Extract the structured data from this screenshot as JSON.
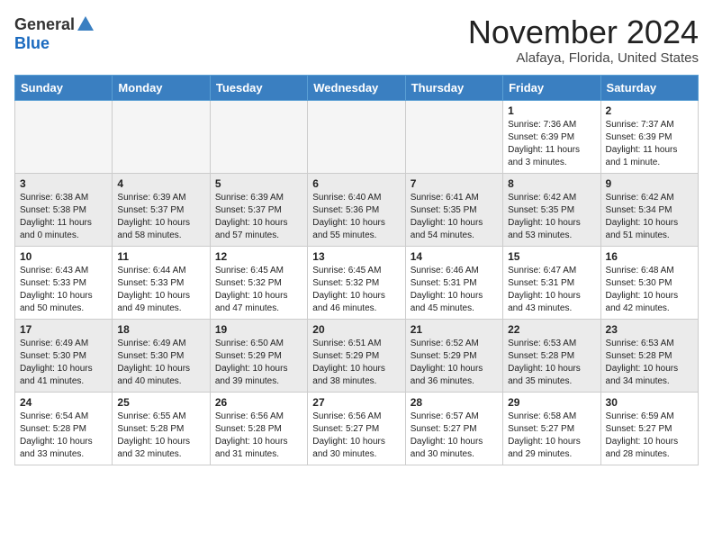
{
  "header": {
    "logo_general": "General",
    "logo_blue": "Blue",
    "month_title": "November 2024",
    "location": "Alafaya, Florida, United States"
  },
  "weekdays": [
    "Sunday",
    "Monday",
    "Tuesday",
    "Wednesday",
    "Thursday",
    "Friday",
    "Saturday"
  ],
  "weeks": [
    [
      {
        "day": "",
        "empty": true
      },
      {
        "day": "",
        "empty": true
      },
      {
        "day": "",
        "empty": true
      },
      {
        "day": "",
        "empty": true
      },
      {
        "day": "",
        "empty": true
      },
      {
        "day": "1",
        "sunrise": "Sunrise: 7:36 AM",
        "sunset": "Sunset: 6:39 PM",
        "daylight": "Daylight: 11 hours and 3 minutes."
      },
      {
        "day": "2",
        "sunrise": "Sunrise: 7:37 AM",
        "sunset": "Sunset: 6:39 PM",
        "daylight": "Daylight: 11 hours and 1 minute."
      }
    ],
    [
      {
        "day": "3",
        "sunrise": "Sunrise: 6:38 AM",
        "sunset": "Sunset: 5:38 PM",
        "daylight": "Daylight: 11 hours and 0 minutes."
      },
      {
        "day": "4",
        "sunrise": "Sunrise: 6:39 AM",
        "sunset": "Sunset: 5:37 PM",
        "daylight": "Daylight: 10 hours and 58 minutes."
      },
      {
        "day": "5",
        "sunrise": "Sunrise: 6:39 AM",
        "sunset": "Sunset: 5:37 PM",
        "daylight": "Daylight: 10 hours and 57 minutes."
      },
      {
        "day": "6",
        "sunrise": "Sunrise: 6:40 AM",
        "sunset": "Sunset: 5:36 PM",
        "daylight": "Daylight: 10 hours and 55 minutes."
      },
      {
        "day": "7",
        "sunrise": "Sunrise: 6:41 AM",
        "sunset": "Sunset: 5:35 PM",
        "daylight": "Daylight: 10 hours and 54 minutes."
      },
      {
        "day": "8",
        "sunrise": "Sunrise: 6:42 AM",
        "sunset": "Sunset: 5:35 PM",
        "daylight": "Daylight: 10 hours and 53 minutes."
      },
      {
        "day": "9",
        "sunrise": "Sunrise: 6:42 AM",
        "sunset": "Sunset: 5:34 PM",
        "daylight": "Daylight: 10 hours and 51 minutes."
      }
    ],
    [
      {
        "day": "10",
        "sunrise": "Sunrise: 6:43 AM",
        "sunset": "Sunset: 5:33 PM",
        "daylight": "Daylight: 10 hours and 50 minutes."
      },
      {
        "day": "11",
        "sunrise": "Sunrise: 6:44 AM",
        "sunset": "Sunset: 5:33 PM",
        "daylight": "Daylight: 10 hours and 49 minutes."
      },
      {
        "day": "12",
        "sunrise": "Sunrise: 6:45 AM",
        "sunset": "Sunset: 5:32 PM",
        "daylight": "Daylight: 10 hours and 47 minutes."
      },
      {
        "day": "13",
        "sunrise": "Sunrise: 6:45 AM",
        "sunset": "Sunset: 5:32 PM",
        "daylight": "Daylight: 10 hours and 46 minutes."
      },
      {
        "day": "14",
        "sunrise": "Sunrise: 6:46 AM",
        "sunset": "Sunset: 5:31 PM",
        "daylight": "Daylight: 10 hours and 45 minutes."
      },
      {
        "day": "15",
        "sunrise": "Sunrise: 6:47 AM",
        "sunset": "Sunset: 5:31 PM",
        "daylight": "Daylight: 10 hours and 43 minutes."
      },
      {
        "day": "16",
        "sunrise": "Sunrise: 6:48 AM",
        "sunset": "Sunset: 5:30 PM",
        "daylight": "Daylight: 10 hours and 42 minutes."
      }
    ],
    [
      {
        "day": "17",
        "sunrise": "Sunrise: 6:49 AM",
        "sunset": "Sunset: 5:30 PM",
        "daylight": "Daylight: 10 hours and 41 minutes."
      },
      {
        "day": "18",
        "sunrise": "Sunrise: 6:49 AM",
        "sunset": "Sunset: 5:30 PM",
        "daylight": "Daylight: 10 hours and 40 minutes."
      },
      {
        "day": "19",
        "sunrise": "Sunrise: 6:50 AM",
        "sunset": "Sunset: 5:29 PM",
        "daylight": "Daylight: 10 hours and 39 minutes."
      },
      {
        "day": "20",
        "sunrise": "Sunrise: 6:51 AM",
        "sunset": "Sunset: 5:29 PM",
        "daylight": "Daylight: 10 hours and 38 minutes."
      },
      {
        "day": "21",
        "sunrise": "Sunrise: 6:52 AM",
        "sunset": "Sunset: 5:29 PM",
        "daylight": "Daylight: 10 hours and 36 minutes."
      },
      {
        "day": "22",
        "sunrise": "Sunrise: 6:53 AM",
        "sunset": "Sunset: 5:28 PM",
        "daylight": "Daylight: 10 hours and 35 minutes."
      },
      {
        "day": "23",
        "sunrise": "Sunrise: 6:53 AM",
        "sunset": "Sunset: 5:28 PM",
        "daylight": "Daylight: 10 hours and 34 minutes."
      }
    ],
    [
      {
        "day": "24",
        "sunrise": "Sunrise: 6:54 AM",
        "sunset": "Sunset: 5:28 PM",
        "daylight": "Daylight: 10 hours and 33 minutes."
      },
      {
        "day": "25",
        "sunrise": "Sunrise: 6:55 AM",
        "sunset": "Sunset: 5:28 PM",
        "daylight": "Daylight: 10 hours and 32 minutes."
      },
      {
        "day": "26",
        "sunrise": "Sunrise: 6:56 AM",
        "sunset": "Sunset: 5:28 PM",
        "daylight": "Daylight: 10 hours and 31 minutes."
      },
      {
        "day": "27",
        "sunrise": "Sunrise: 6:56 AM",
        "sunset": "Sunset: 5:27 PM",
        "daylight": "Daylight: 10 hours and 30 minutes."
      },
      {
        "day": "28",
        "sunrise": "Sunrise: 6:57 AM",
        "sunset": "Sunset: 5:27 PM",
        "daylight": "Daylight: 10 hours and 30 minutes."
      },
      {
        "day": "29",
        "sunrise": "Sunrise: 6:58 AM",
        "sunset": "Sunset: 5:27 PM",
        "daylight": "Daylight: 10 hours and 29 minutes."
      },
      {
        "day": "30",
        "sunrise": "Sunrise: 6:59 AM",
        "sunset": "Sunset: 5:27 PM",
        "daylight": "Daylight: 10 hours and 28 minutes."
      }
    ]
  ]
}
